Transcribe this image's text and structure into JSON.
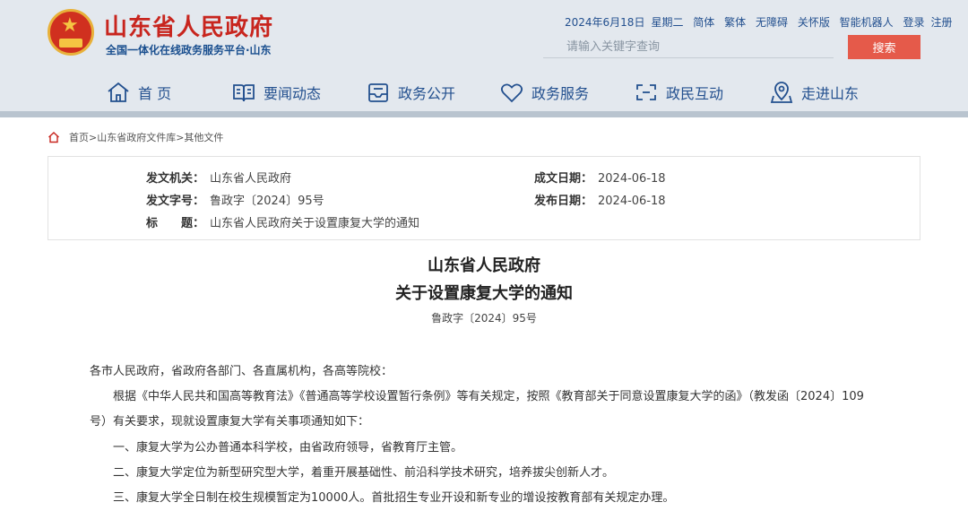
{
  "header": {
    "site_title": "山东省人民政府",
    "site_subtitle": "全国一体化在线政务服务平台·山东",
    "date": "2024年6月18日",
    "weekday": "星期二",
    "links": [
      "简体",
      "繁体",
      "无障碍",
      "关怀版",
      "智能机器人",
      "登录",
      "注册"
    ],
    "search_placeholder": "请输入关键字查询",
    "search_button": "搜索",
    "accent_color": "#c8251e",
    "link_color": "#23508f"
  },
  "nav": {
    "items": [
      {
        "label": "首 页",
        "icon": "home-icon"
      },
      {
        "label": "要闻动态",
        "icon": "book-icon"
      },
      {
        "label": "政务公开",
        "icon": "inbox-icon"
      },
      {
        "label": "政务服务",
        "icon": "heart-icon"
      },
      {
        "label": "政民互动",
        "icon": "interaction-icon"
      },
      {
        "label": "走进山东",
        "icon": "map-pin-icon"
      }
    ]
  },
  "breadcrumb": {
    "icon": "home-icon",
    "text": "首页>山东省政府文件库>其他文件"
  },
  "meta": {
    "issuer_label": "发文机关：",
    "issuer": "山东省人民政府",
    "created_label": "成文日期：",
    "created": "2024-06-18",
    "doc_no_label": "发文字号：",
    "doc_no": "鲁政字〔2024〕95号",
    "published_label": "发布日期：",
    "published": "2024-06-18",
    "title_label": "标　　题：",
    "title": "山东省人民政府关于设置康复大学的通知"
  },
  "document": {
    "title_line1": "山东省人民政府",
    "title_line2": "关于设置康复大学的通知",
    "doc_number": "鲁政字〔2024〕95号",
    "salutation": "各市人民政府，省政府各部门、各直属机构，各高等院校：",
    "para1_line1": "根据《中华人民共和国高等教育法》《普通高等学校设置暂行条例》等有关规定，按照《教育部关于同意设置康复大学的函》（教发函〔2024〕109",
    "para1_line2": "号）有关要求，现就设置康复大学有关事项通知如下：",
    "item1": "一、康复大学为公办普通本科学校，由省政府领导，省教育厅主管。",
    "item2": "二、康复大学定位为新型研究型大学，着重开展基础性、前沿科学技术研究，培养拔尖创新人才。",
    "item3": "三、康复大学全日制在校生规模暂定为10000人。首批招生专业开设和新专业的增设按教育部有关规定办理。"
  }
}
